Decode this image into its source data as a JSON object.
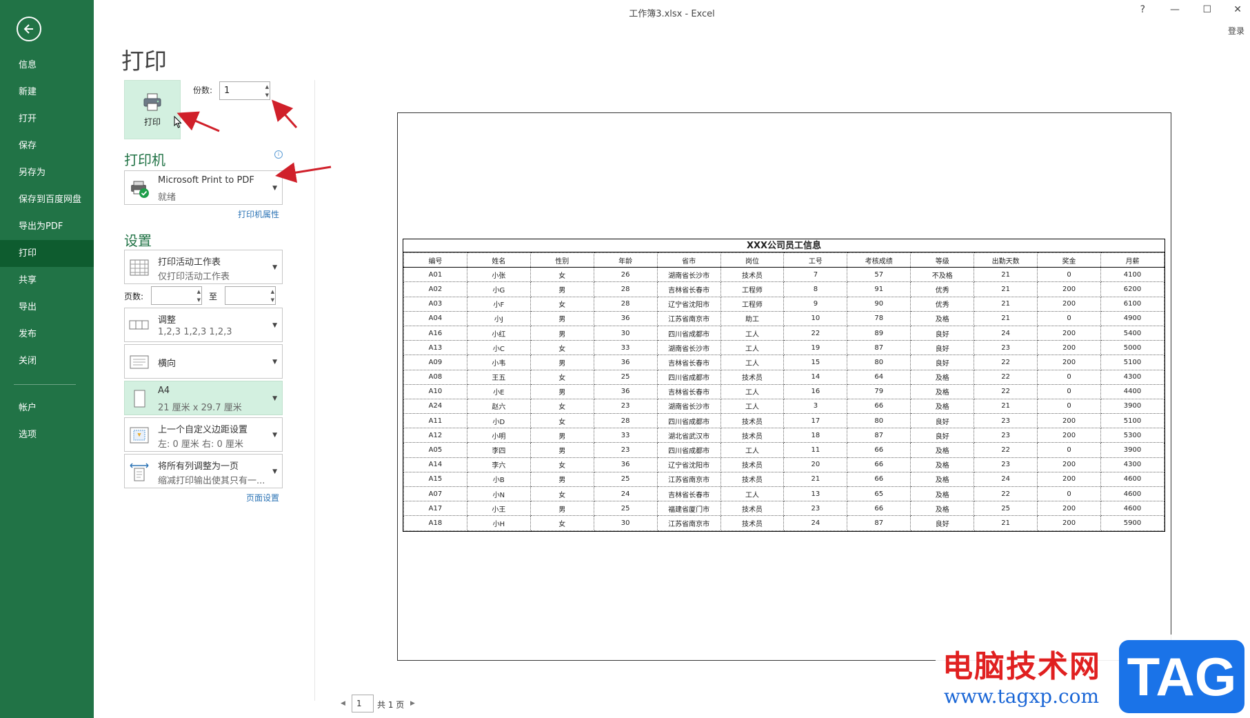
{
  "window": {
    "title": "工作簿3.xlsx - Excel",
    "help": "?",
    "minimize": "—",
    "maximize": "☐",
    "close": "✕",
    "login": "登录"
  },
  "sidebar": {
    "items": [
      {
        "label": "信息"
      },
      {
        "label": "新建"
      },
      {
        "label": "打开"
      },
      {
        "label": "保存"
      },
      {
        "label": "另存为"
      },
      {
        "label": "保存到百度网盘"
      },
      {
        "label": "导出为PDF"
      },
      {
        "label": "打印",
        "active": true
      },
      {
        "label": "共享"
      },
      {
        "label": "导出"
      },
      {
        "label": "发布"
      },
      {
        "label": "关闭"
      }
    ],
    "bottom_items": [
      {
        "label": "帐户"
      },
      {
        "label": "选项"
      }
    ]
  },
  "print": {
    "page_title": "打印",
    "print_button": "打印",
    "copies_label": "份数:",
    "copies_value": "1"
  },
  "printer": {
    "section_title": "打印机",
    "name": "Microsoft Print to PDF",
    "status": "就绪",
    "properties_link": "打印机属性"
  },
  "settings": {
    "section_title": "设置",
    "scope": {
      "line1": "打印活动工作表",
      "line2": "仅打印活动工作表"
    },
    "pages_label": "页数:",
    "pages_to": "至",
    "collate": {
      "line1": "调整",
      "line2": "1,2,3    1,2,3    1,2,3"
    },
    "orientation": {
      "line1": "横向"
    },
    "paper": {
      "line1": "A4",
      "line2": "21 厘米 x 29.7 厘米"
    },
    "margins": {
      "line1": "上一个自定义边距设置",
      "line2": "左: 0 厘米      右: 0 厘米"
    },
    "scaling": {
      "line1": "将所有列调整为一页",
      "line2": "缩减打印输出使其只有一..."
    },
    "page_setup_link": "页面设置"
  },
  "preview": {
    "sheet_title": "XXX公司员工信息",
    "headers": [
      "编号",
      "姓名",
      "性别",
      "年龄",
      "省市",
      "岗位",
      "工号",
      "考核成绩",
      "等级",
      "出勤天数",
      "奖金",
      "月薪"
    ],
    "rows": [
      [
        "A01",
        "小张",
        "女",
        "26",
        "湖南省长沙市",
        "技术员",
        "7",
        "57",
        "不及格",
        "21",
        "0",
        "4100"
      ],
      [
        "A02",
        "小G",
        "男",
        "28",
        "吉林省长春市",
        "工程师",
        "8",
        "91",
        "优秀",
        "21",
        "200",
        "6200"
      ],
      [
        "A03",
        "小F",
        "女",
        "28",
        "辽宁省沈阳市",
        "工程师",
        "9",
        "90",
        "优秀",
        "21",
        "200",
        "6100"
      ],
      [
        "A04",
        "小J",
        "男",
        "36",
        "江苏省南京市",
        "助工",
        "10",
        "78",
        "及格",
        "21",
        "0",
        "4900"
      ],
      [
        "A16",
        "小红",
        "男",
        "30",
        "四川省成都市",
        "工人",
        "22",
        "89",
        "良好",
        "24",
        "200",
        "5400"
      ],
      [
        "A13",
        "小C",
        "女",
        "33",
        "湖南省长沙市",
        "工人",
        "19",
        "87",
        "良好",
        "23",
        "200",
        "5000"
      ],
      [
        "A09",
        "小韦",
        "男",
        "36",
        "吉林省长春市",
        "工人",
        "15",
        "80",
        "良好",
        "22",
        "200",
        "5100"
      ],
      [
        "A08",
        "王五",
        "女",
        "25",
        "四川省成都市",
        "技术员",
        "14",
        "64",
        "及格",
        "22",
        "0",
        "4300"
      ],
      [
        "A10",
        "小E",
        "男",
        "36",
        "吉林省长春市",
        "工人",
        "16",
        "79",
        "及格",
        "22",
        "0",
        "4400"
      ],
      [
        "A24",
        "赵六",
        "女",
        "23",
        "湖南省长沙市",
        "工人",
        "3",
        "66",
        "及格",
        "21",
        "0",
        "3900"
      ],
      [
        "A11",
        "小D",
        "女",
        "28",
        "四川省成都市",
        "技术员",
        "17",
        "80",
        "良好",
        "23",
        "200",
        "5100"
      ],
      [
        "A12",
        "小明",
        "男",
        "33",
        "湖北省武汉市",
        "技术员",
        "18",
        "87",
        "良好",
        "23",
        "200",
        "5300"
      ],
      [
        "A05",
        "李四",
        "男",
        "23",
        "四川省成都市",
        "工人",
        "11",
        "66",
        "及格",
        "22",
        "0",
        "3900"
      ],
      [
        "A14",
        "李六",
        "女",
        "36",
        "辽宁省沈阳市",
        "技术员",
        "20",
        "66",
        "及格",
        "23",
        "200",
        "4300"
      ],
      [
        "A15",
        "小B",
        "男",
        "25",
        "江苏省南京市",
        "技术员",
        "21",
        "66",
        "及格",
        "24",
        "200",
        "4600"
      ],
      [
        "A07",
        "小N",
        "女",
        "24",
        "吉林省长春市",
        "工人",
        "13",
        "65",
        "及格",
        "22",
        "0",
        "4600"
      ],
      [
        "A17",
        "小王",
        "男",
        "25",
        "福建省厦门市",
        "技术员",
        "23",
        "66",
        "及格",
        "25",
        "200",
        "4600"
      ],
      [
        "A18",
        "小H",
        "女",
        "30",
        "江苏省南京市",
        "技术员",
        "24",
        "87",
        "良好",
        "21",
        "200",
        "5900"
      ]
    ],
    "page_current": "1",
    "page_total": "共 1 页"
  },
  "watermark": {
    "cn": "电脑技术网",
    "url": "www.tagxp.com",
    "tag": "TAG"
  },
  "colors": {
    "accent": "#217346",
    "accent_dark": "#0e5c2f",
    "selected_bg": "#d3f0e0",
    "link": "#2e75b6",
    "annotation": "#d0202a"
  }
}
